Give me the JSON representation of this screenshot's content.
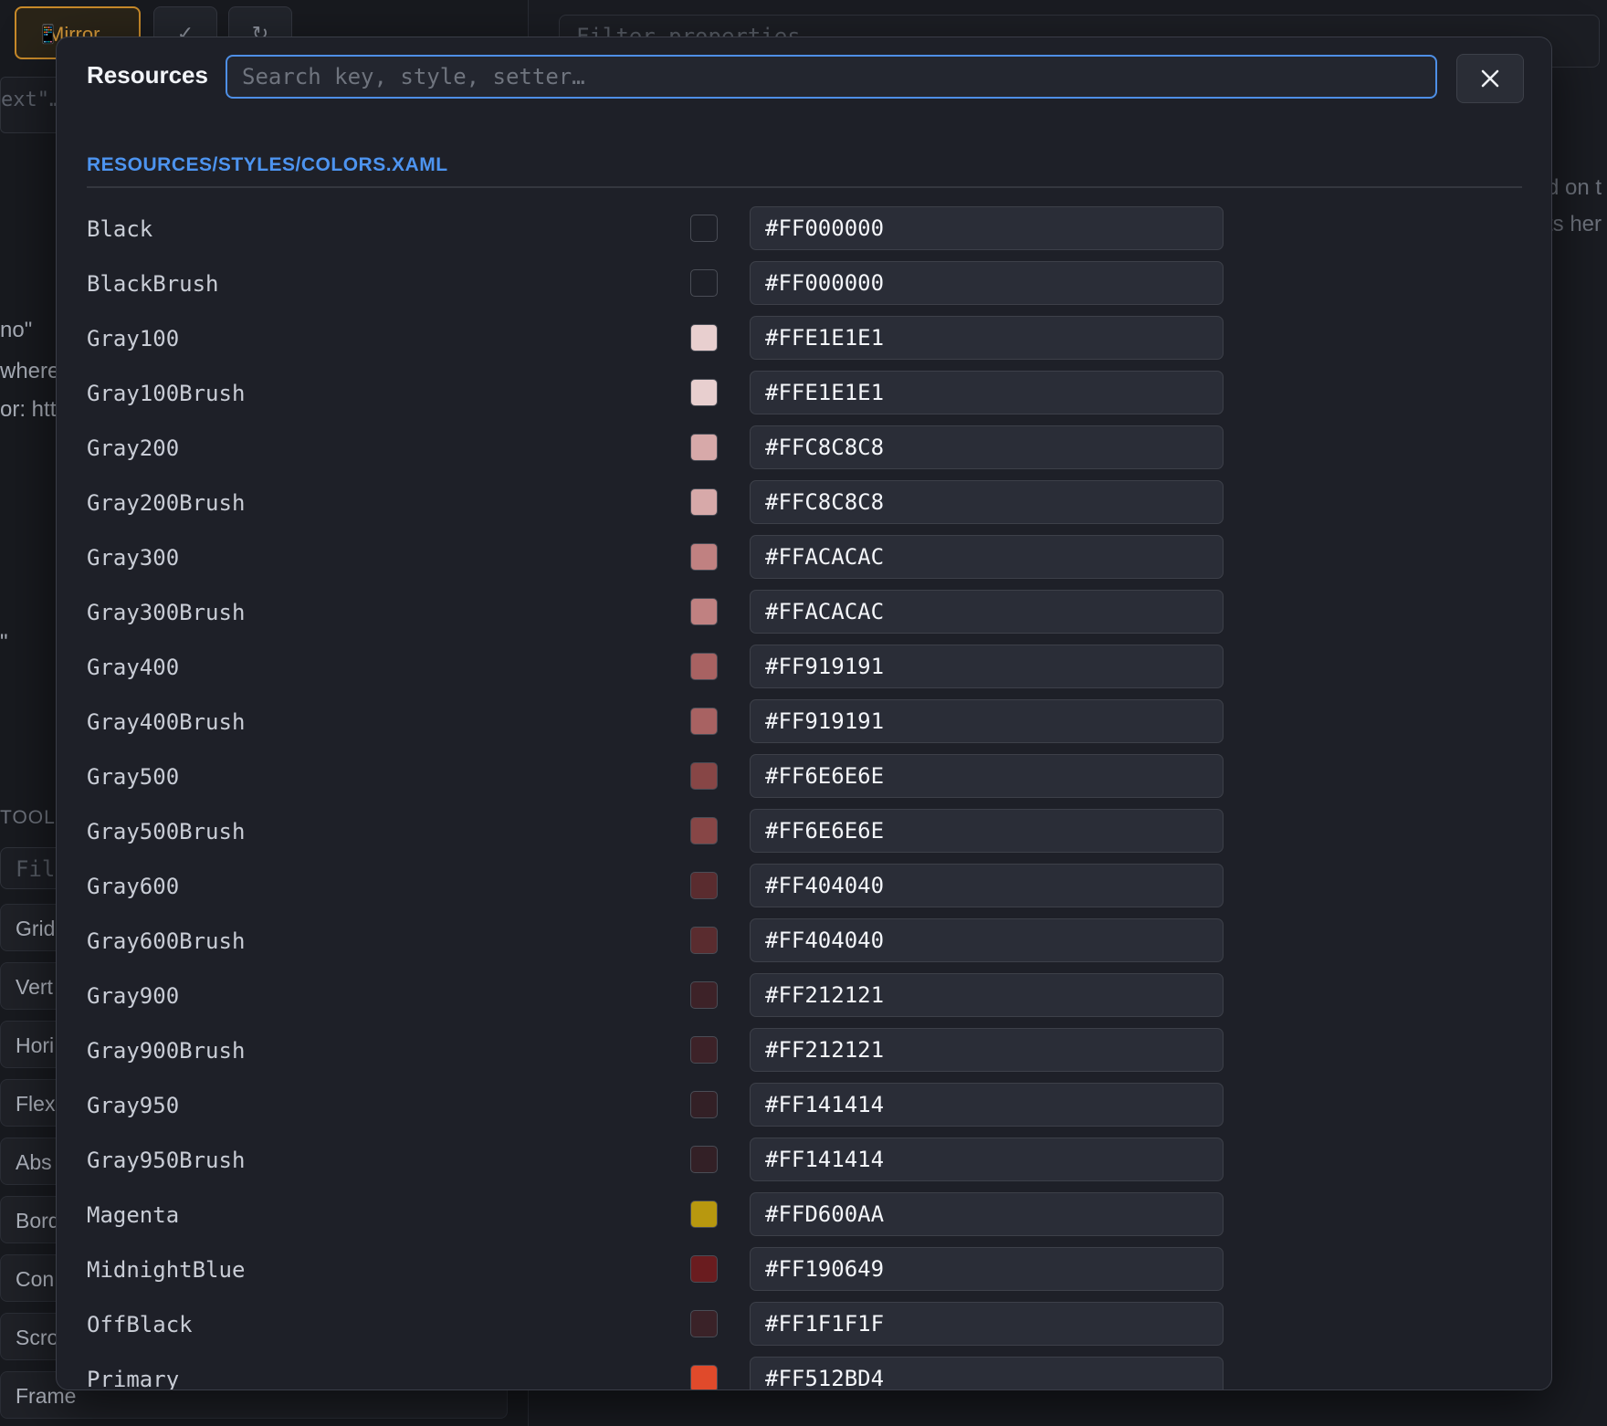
{
  "background": {
    "toolbar": {
      "mirror_label": "Mirror",
      "mirror_icon": "📱",
      "btn2_glyph": "✓",
      "btn3_glyph": "↻"
    },
    "left_input_text": "ext\"…",
    "left_fragments": [
      "no\"",
      "where",
      "or: htt",
      "\""
    ],
    "toolbox_title": "TOOL",
    "toolbox_filter": "Fil",
    "toolbox_items": [
      "Grid",
      "Vert",
      "Hori",
      "Flex",
      "Abs",
      "Bord",
      "Con",
      "Scro",
      "Frame"
    ],
    "properties_filter_placeholder": "Filter properties",
    "right_fragments": [
      "d on t",
      "ts her"
    ]
  },
  "modal": {
    "title": "Resources",
    "search_placeholder": "Search key, style, setter…",
    "search_value": "",
    "section_title": "RESOURCES/STYLES/COLORS.XAML",
    "close_icon": "close-icon",
    "rows": [
      {
        "key": "Black",
        "value": "#FF000000",
        "swatch": "#1e2028"
      },
      {
        "key": "BlackBrush",
        "value": "#FF000000",
        "swatch": "#1e2028"
      },
      {
        "key": "Gray100",
        "value": "#FFE1E1E1",
        "swatch": "#e8cfcf"
      },
      {
        "key": "Gray100Brush",
        "value": "#FFE1E1E1",
        "swatch": "#e8cfcf"
      },
      {
        "key": "Gray200",
        "value": "#FFC8C8C8",
        "swatch": "#d7a9a9"
      },
      {
        "key": "Gray200Brush",
        "value": "#FFC8C8C8",
        "swatch": "#d7a9a9"
      },
      {
        "key": "Gray300",
        "value": "#FFACACAC",
        "swatch": "#c08181"
      },
      {
        "key": "Gray300Brush",
        "value": "#FFACACAC",
        "swatch": "#c08181"
      },
      {
        "key": "Gray400",
        "value": "#FF919191",
        "swatch": "#a86262"
      },
      {
        "key": "Gray400Brush",
        "value": "#FF919191",
        "swatch": "#a86262"
      },
      {
        "key": "Gray500",
        "value": "#FF6E6E6E",
        "swatch": "#874646"
      },
      {
        "key": "Gray500Brush",
        "value": "#FF6E6E6E",
        "swatch": "#874646"
      },
      {
        "key": "Gray600",
        "value": "#FF404040",
        "swatch": "#5a2c2f"
      },
      {
        "key": "Gray600Brush",
        "value": "#FF404040",
        "swatch": "#5a2c2f"
      },
      {
        "key": "Gray900",
        "value": "#FF212121",
        "swatch": "#3d2228"
      },
      {
        "key": "Gray900Brush",
        "value": "#FF212121",
        "swatch": "#3d2228"
      },
      {
        "key": "Gray950",
        "value": "#FF141414",
        "swatch": "#332026"
      },
      {
        "key": "Gray950Brush",
        "value": "#FF141414",
        "swatch": "#332026"
      },
      {
        "key": "Magenta",
        "value": "#FFD600AA",
        "swatch": "#b8980f"
      },
      {
        "key": "MidnightBlue",
        "value": "#FF190649",
        "swatch": "#6a1c1f"
      },
      {
        "key": "OffBlack",
        "value": "#FF1F1F1F",
        "swatch": "#3a2228"
      },
      {
        "key": "Primary",
        "value": "#FF512BD4",
        "swatch": "#e04a2b"
      }
    ]
  }
}
